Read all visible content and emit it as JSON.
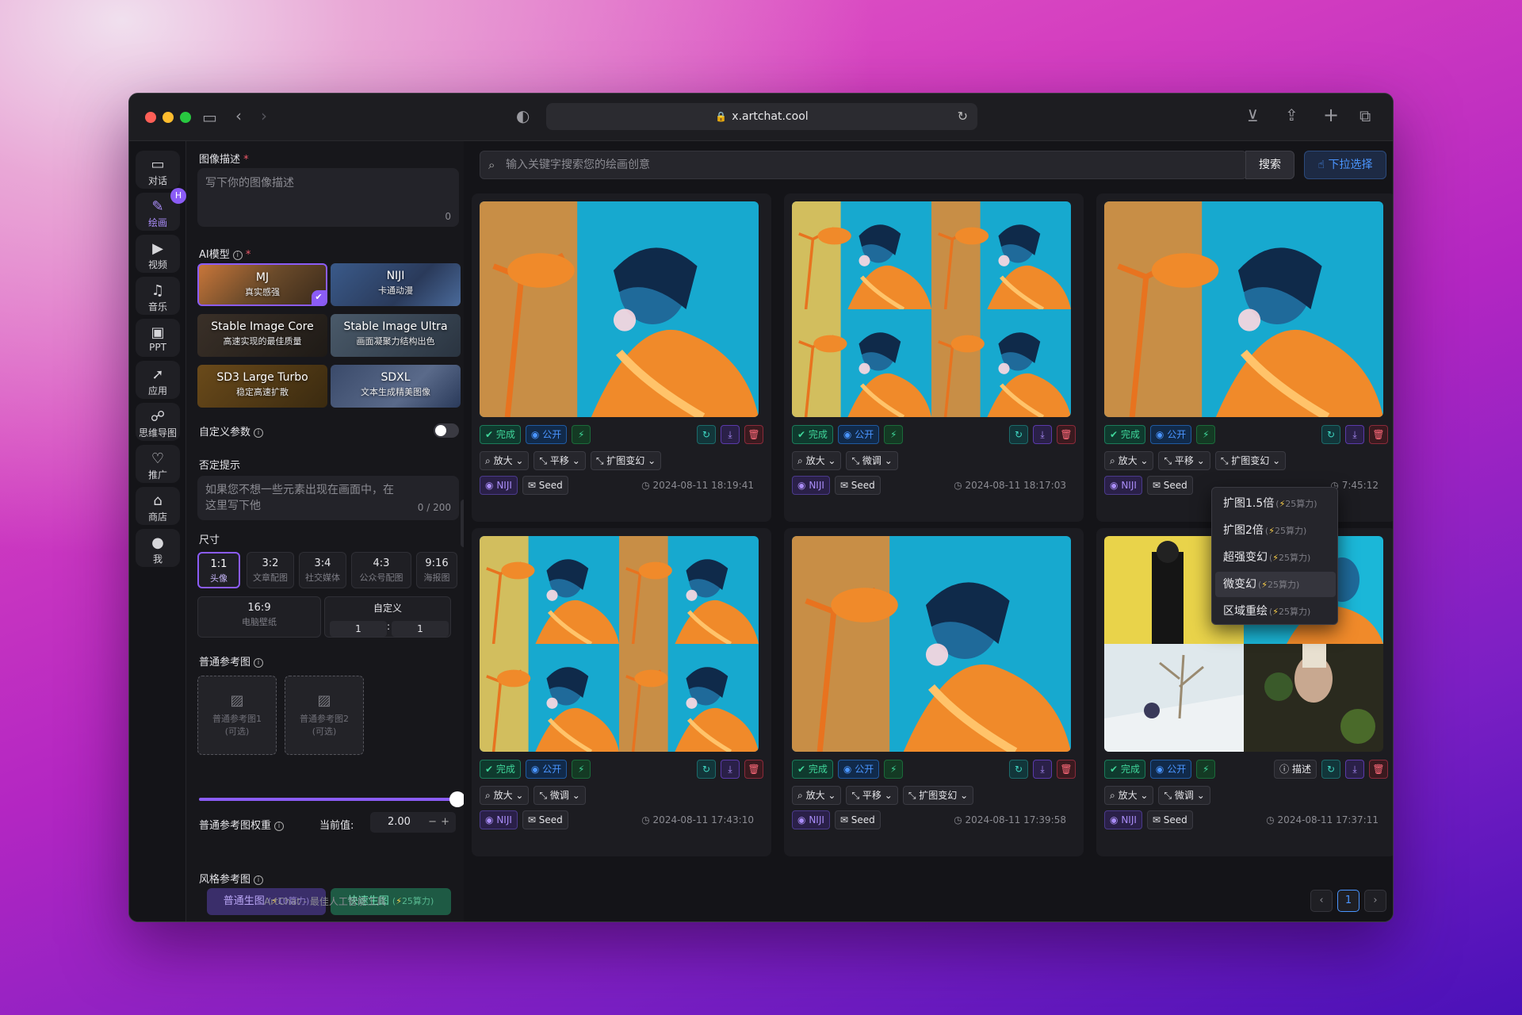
{
  "browser": {
    "url": "x.artchat.cool"
  },
  "rail": [
    {
      "label": "对话",
      "icon": "chat-icon"
    },
    {
      "label": "绘画",
      "icon": "paint-brush-icon",
      "badge": "H",
      "active": true
    },
    {
      "label": "视频",
      "icon": "video-icon"
    },
    {
      "label": "音乐",
      "icon": "music-icon"
    },
    {
      "label": "PPT",
      "icon": "presentation-icon"
    },
    {
      "label": "应用",
      "icon": "rocket-icon"
    },
    {
      "label": "思维导图",
      "icon": "mindmap-icon"
    },
    {
      "label": "推广",
      "icon": "handshake-icon"
    },
    {
      "label": "商店",
      "icon": "store-icon"
    },
    {
      "label": "我",
      "icon": "user-icon"
    }
  ],
  "panel": {
    "desc_label": "图像描述",
    "desc_placeholder": "写下你的图像描述",
    "desc_count": "0",
    "model_label": "AI模型",
    "models": [
      {
        "title": "MJ",
        "sub": "真实感强",
        "selected": true
      },
      {
        "title": "NIJI",
        "sub": "卡通动漫"
      },
      {
        "title": "Stable Image Core",
        "sub": "高速实现的最佳质量"
      },
      {
        "title": "Stable Image Ultra",
        "sub": "画面凝聚力结构出色"
      },
      {
        "title": "SD3 Large Turbo",
        "sub": "稳定高速扩散"
      },
      {
        "title": "SDXL",
        "sub": "文本生成精美图像"
      }
    ],
    "custom_params_label": "自定义参数",
    "negative_label": "否定提示",
    "negative_placeholder": "如果您不想一些元素出现在画面中，在这里写下他",
    "negative_count": "0 / 200",
    "size_label": "尺寸",
    "sizes": [
      {
        "ratio": "1:1",
        "use": "头像",
        "selected": true
      },
      {
        "ratio": "3:2",
        "use": "文章配图"
      },
      {
        "ratio": "3:4",
        "use": "社交媒体"
      },
      {
        "ratio": "4:3",
        "use": "公众号配图"
      },
      {
        "ratio": "9:16",
        "use": "海报图"
      },
      {
        "ratio": "16:9",
        "use": "电脑壁纸"
      }
    ],
    "custom_size": {
      "label": "自定义",
      "w": "1",
      "sep": ":",
      "h": "1"
    },
    "ref_label": "普通参考图",
    "refs": [
      {
        "line1": "普通参考图1",
        "line2": "(可选)"
      },
      {
        "line1": "普通参考图2",
        "line2": "(可选)"
      }
    ],
    "weight_label": "普通参考图权重",
    "current_label": "当前值:",
    "weight_value": "2.00",
    "weight_fraction": 1.0,
    "style_ref_label": "风格参考图",
    "btn_normal": "普通生图",
    "btn_normal_cost": "10算力",
    "btn_fast": "快速生图",
    "btn_fast_cost": "25算力"
  },
  "main": {
    "search_placeholder": "输入关键字搜索您的绘画创意",
    "search_btn": "搜索",
    "dropdown_btn": "下拉选择",
    "labels": {
      "done": "完成",
      "public": "公开",
      "zoom": "放大",
      "pan": "平移",
      "fine": "微调",
      "expand": "扩图变幻",
      "niji": "NIJI",
      "seed": "Seed",
      "describe": "描述"
    },
    "cards": [
      {
        "row2": [
          "zoom",
          "pan",
          "expand"
        ],
        "time": "2024-08-11 18:19:41",
        "grid": false
      },
      {
        "row2": [
          "zoom",
          "fine"
        ],
        "time": "2024-08-11 18:17:03",
        "grid": true
      },
      {
        "row2": [
          "zoom",
          "pan",
          "expand"
        ],
        "time": "7:45:12",
        "grid": false
      },
      {
        "row2": [
          "zoom",
          "fine"
        ],
        "time": "2024-08-11 17:43:10",
        "grid": true
      },
      {
        "row2": [
          "zoom",
          "pan",
          "expand"
        ],
        "time": "2024-08-11 17:39:58",
        "grid": false
      },
      {
        "row2": [
          "zoom",
          "fine"
        ],
        "time": "2024-08-11 17:37:11",
        "grid": true,
        "describe": true
      }
    ],
    "dropdown": [
      {
        "label": "扩图1.5倍",
        "cost": "25算力"
      },
      {
        "label": "扩图2倍",
        "cost": "25算力"
      },
      {
        "label": "超强变幻",
        "cost": "25算力"
      },
      {
        "label": "微变幻",
        "cost": "25算力",
        "highlight": true
      },
      {
        "label": "区域重绘",
        "cost": "25算力"
      }
    ]
  },
  "footer": {
    "text": "ArtChat - 最佳人工智能工具",
    "page": "1"
  }
}
